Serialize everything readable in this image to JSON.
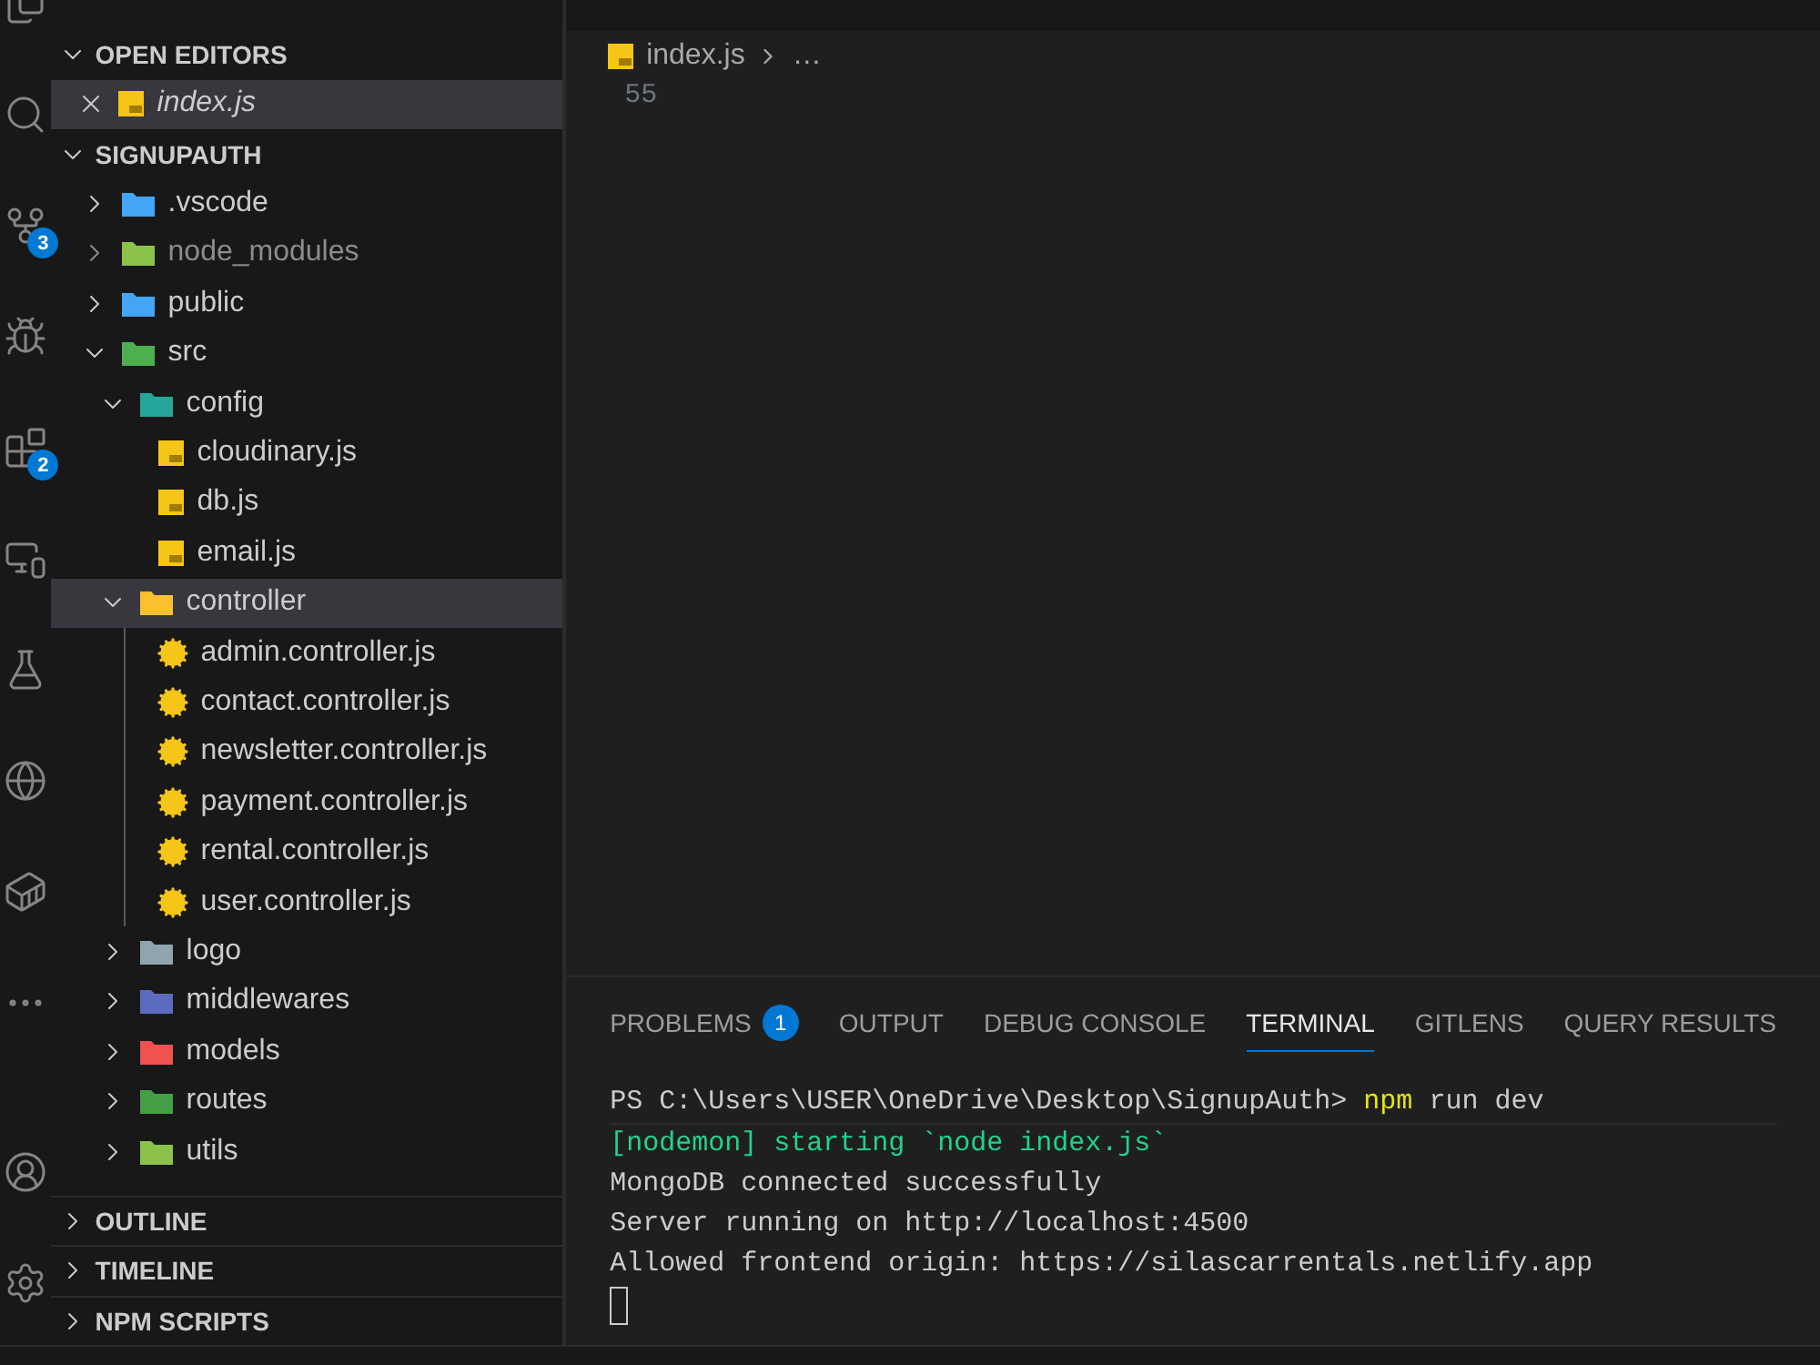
{
  "activity_bar": {
    "source_control_badge": "3",
    "extensions_badge": "2"
  },
  "sidebar": {
    "open_editors": {
      "title": "OPEN EDITORS",
      "expanded": true,
      "items": [
        {
          "label": "index.js",
          "selected": true
        }
      ]
    },
    "project": {
      "title": "SIGNUPAUTH",
      "expanded": true,
      "tree": [
        {
          "label": ".vscode",
          "kind": "folder",
          "color": "#42a5f5",
          "expanded": false,
          "ignored": false,
          "selected": false
        },
        {
          "label": "node_modules",
          "kind": "folder",
          "color": "#8bc34a",
          "expanded": false,
          "ignored": true,
          "selected": false
        },
        {
          "label": "public",
          "kind": "folder",
          "color": "#42a5f5",
          "expanded": false,
          "ignored": false,
          "selected": false
        },
        {
          "label": "src",
          "kind": "folder",
          "color": "#4caf50",
          "expanded": true,
          "ignored": false,
          "selected": false,
          "children": [
            {
              "label": "config",
              "kind": "folder",
              "color": "#26a69a",
              "expanded": true,
              "ignored": false,
              "selected": false,
              "children": [
                {
                  "label": "cloudinary.js",
                  "kind": "script",
                  "ignored": false,
                  "selected": false
                },
                {
                  "label": "db.js",
                  "kind": "script",
                  "ignored": false,
                  "selected": false
                },
                {
                  "label": "email.js",
                  "kind": "script",
                  "ignored": false,
                  "selected": false
                }
              ]
            },
            {
              "label": "controller",
              "kind": "folder",
              "color": "#fbc02d",
              "expanded": true,
              "ignored": false,
              "selected": true,
              "children": [
                {
                  "label": "admin.controller.js",
                  "kind": "controller",
                  "ignored": false,
                  "selected": false
                },
                {
                  "label": "contact.controller.js",
                  "kind": "controller",
                  "ignored": false,
                  "selected": false
                },
                {
                  "label": "newsletter.controller.js",
                  "kind": "controller",
                  "ignored": false,
                  "selected": false
                },
                {
                  "label": "payment.controller.js",
                  "kind": "controller",
                  "ignored": false,
                  "selected": false
                },
                {
                  "label": "rental.controller.js",
                  "kind": "controller",
                  "ignored": false,
                  "selected": false
                },
                {
                  "label": "user.controller.js",
                  "kind": "controller",
                  "ignored": false,
                  "selected": false
                }
              ]
            },
            {
              "label": "logo",
              "kind": "folder",
              "color": "#90a4ae",
              "expanded": false,
              "ignored": false,
              "selected": false
            },
            {
              "label": "middlewares",
              "kind": "folder",
              "color": "#5c6bc0",
              "expanded": false,
              "ignored": false,
              "selected": false
            },
            {
              "label": "models",
              "kind": "folder",
              "color": "#ef5350",
              "expanded": false,
              "ignored": false,
              "selected": false
            },
            {
              "label": "routes",
              "kind": "folder",
              "color": "#43a047",
              "expanded": false,
              "ignored": false,
              "selected": false
            },
            {
              "label": "utils",
              "kind": "folder",
              "color": "#8bc34a",
              "expanded": false,
              "ignored": false,
              "selected": false
            }
          ]
        }
      ]
    },
    "sections": [
      {
        "title": "OUTLINE",
        "expanded": false
      },
      {
        "title": "TIMELINE",
        "expanded": false
      },
      {
        "title": "NPM SCRIPTS",
        "expanded": false
      }
    ]
  },
  "editor": {
    "breadcrumb": {
      "file": "index.js",
      "rest": "…"
    },
    "line_numbers": [
      "55"
    ]
  },
  "panel": {
    "tabs": [
      {
        "label": "PROBLEMS",
        "badge": "1",
        "selected": false
      },
      {
        "label": "OUTPUT",
        "selected": false
      },
      {
        "label": "DEBUG CONSOLE",
        "selected": false
      },
      {
        "label": "TERMINAL",
        "selected": true
      },
      {
        "label": "GITLENS",
        "selected": false
      },
      {
        "label": "QUERY RESULTS",
        "selected": false
      }
    ],
    "terminal": {
      "prompt": "PS C:\\Users\\USER\\OneDrive\\Desktop\\SignupAuth>",
      "command": "npm",
      "args": "run dev",
      "lines": [
        {
          "text": "[nodemon] starting `node index.js`",
          "kind": "info"
        },
        {
          "text": "MongoDB connected successfully",
          "kind": "plain"
        },
        {
          "text": "Server running on http://localhost:4500",
          "kind": "plain"
        },
        {
          "text": "Allowed frontend origin: https://silascarrentals.netlify.app",
          "kind": "plain"
        }
      ]
    }
  }
}
